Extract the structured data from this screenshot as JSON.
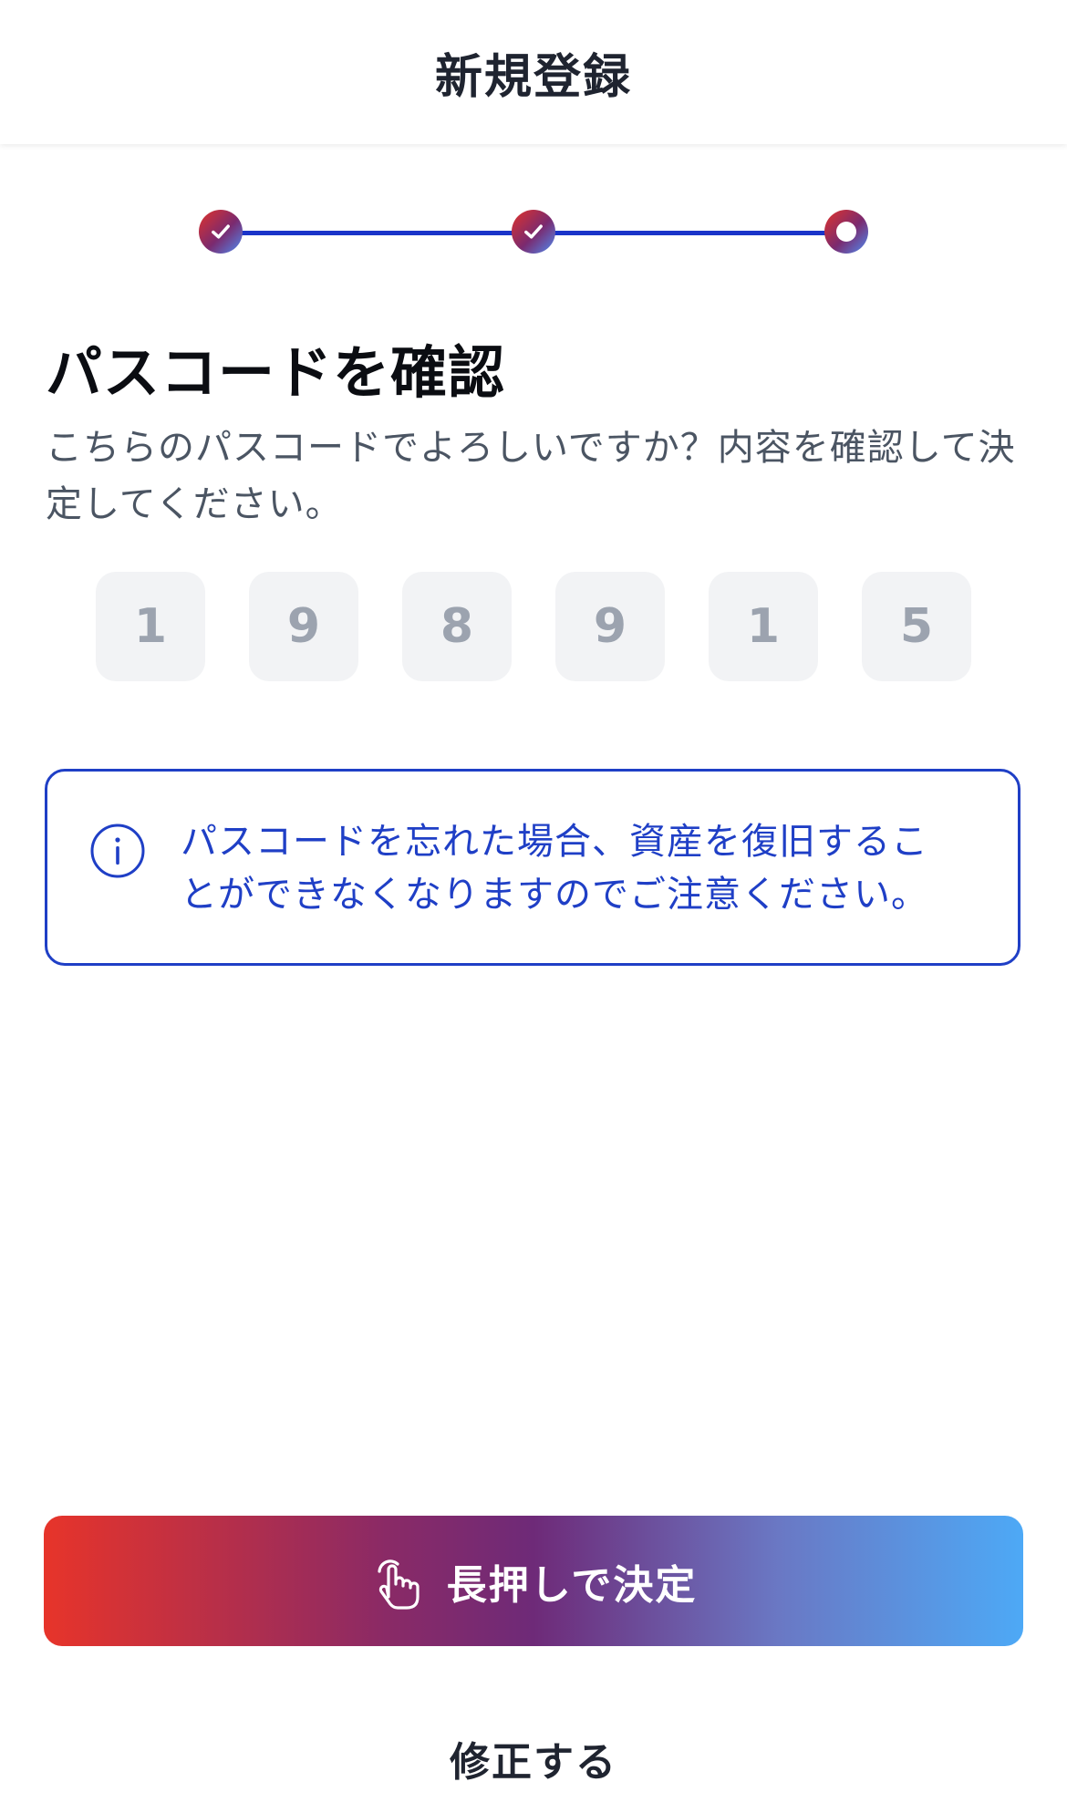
{
  "header": {
    "title": "新規登録"
  },
  "stepper": {
    "steps": [
      {
        "state": "completed"
      },
      {
        "state": "completed"
      },
      {
        "state": "current"
      }
    ],
    "line_color": "#1a34c9"
  },
  "main": {
    "title": "パスコードを確認",
    "description": "こちらのパスコードでよろしいですか？内容を確認して決定してください。",
    "passcode_digits": [
      "1",
      "9",
      "8",
      "9",
      "1",
      "5"
    ]
  },
  "notice": {
    "icon": "info-icon",
    "text": "パスコードを忘れた場合、資産を復旧することができなくなりますのでご注意ください。",
    "color": "#1f3fc6"
  },
  "actions": {
    "primary_label": "長押しで決定",
    "primary_icon": "tap-hand-icon",
    "secondary_label": "修正する"
  },
  "colors": {
    "gradient_start": "#e7342a",
    "gradient_mid": "#6e2a78",
    "gradient_end": "#4da9f6"
  }
}
